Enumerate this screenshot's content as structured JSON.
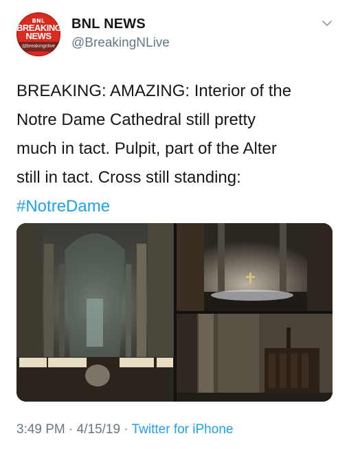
{
  "author": {
    "avatar": {
      "top_text": "BNL",
      "line1": "BREAKING",
      "line2": "NEWS",
      "handle_text": "@breakingnlive"
    },
    "display_name": "BNL NEWS",
    "username": "@BreakingNLive",
    "menu_icon": "chevron-down-icon"
  },
  "tweet": {
    "lines": [
      "BREAKING: AMAZING: Interior of the",
      "Notre Dame Cathedral still pretty",
      "much in tact. Pulpit, part of the Alter",
      "still in tact. Cross still standing:"
    ],
    "hashtag": "#NotreDame"
  },
  "media": {
    "photos": [
      "cathedral-nave-photo",
      "altar-cross-photo",
      "pulpit-photo"
    ]
  },
  "footer": {
    "time": "3:49 PM",
    "separator": " · ",
    "date": "4/15/19",
    "source": "Twitter for iPhone"
  },
  "colors": {
    "link": "#1da1f2",
    "secondary_text": "#657786",
    "avatar_red": "#d92b1f"
  }
}
